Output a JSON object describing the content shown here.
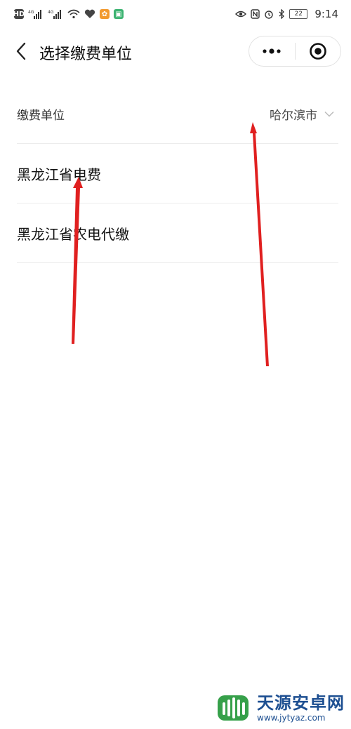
{
  "status_bar": {
    "left_icons": [
      "hd-icon",
      "signal-icon-1",
      "signal-icon-2",
      "wifi-icon",
      "heart-icon",
      "app-icon-orange",
      "app-icon-green"
    ],
    "network_label_1": "4G",
    "network_label_2": "4G",
    "battery_level": "22",
    "time": "9:14"
  },
  "nav": {
    "title": "选择缴费单位"
  },
  "list": {
    "header_label": "缴费单位",
    "city_value": "哈尔滨市",
    "items": [
      {
        "label": "黑龙江省电费"
      },
      {
        "label": "黑龙江省农电代缴"
      }
    ]
  },
  "watermark": {
    "title": "天源安卓网",
    "url": "www.jytyaz.com"
  },
  "colors": {
    "annotation_arrow": "#e02020",
    "watermark_blue": "#1d4f91",
    "watermark_green": "#36a04a"
  }
}
